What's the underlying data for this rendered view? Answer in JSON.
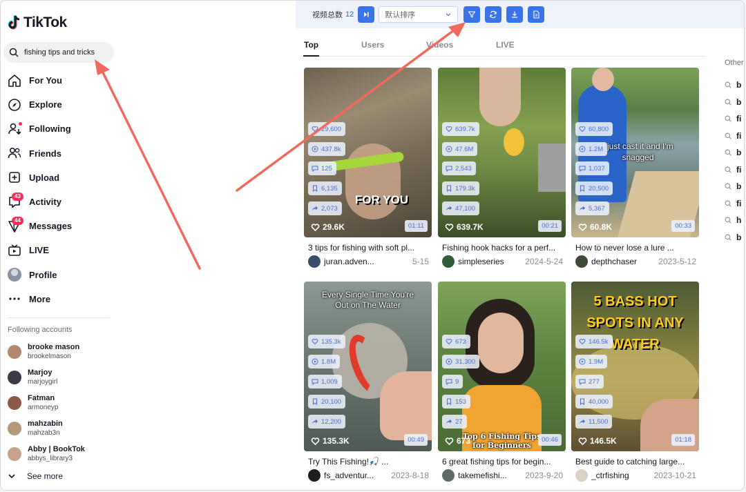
{
  "brand": {
    "logo_text": "TikTok"
  },
  "search": {
    "value": "fishing tips and tricks"
  },
  "nav": [
    {
      "label": "For You",
      "icon": "home-icon"
    },
    {
      "label": "Explore",
      "icon": "compass-icon"
    },
    {
      "label": "Following",
      "icon": "following-icon"
    },
    {
      "label": "Friends",
      "icon": "friends-icon"
    },
    {
      "label": "Upload",
      "icon": "upload-icon"
    },
    {
      "label": "Activity",
      "icon": "activity-icon",
      "badge": "43"
    },
    {
      "label": "Messages",
      "icon": "messages-icon",
      "badge": "44"
    },
    {
      "label": "LIVE",
      "icon": "live-icon"
    },
    {
      "label": "Profile",
      "icon": "avatar"
    },
    {
      "label": "More",
      "icon": "more-icon"
    }
  ],
  "following": {
    "title": "Following accounts",
    "accounts": [
      {
        "name": "brooke mason",
        "user": "brookelmason",
        "color": "#b08a6e"
      },
      {
        "name": "Marjoy",
        "user": "marjoygirl",
        "color": "#3c3a44"
      },
      {
        "name": "Fatman",
        "user": "armoneyp",
        "color": "#8c5a4a"
      },
      {
        "name": "mahzabin",
        "user": "mahzab3n",
        "color": "#b49a7a"
      },
      {
        "name": "Abby | BookTok",
        "user": "abbys_library3",
        "color": "#c7a38e"
      }
    ],
    "see_more": "See more"
  },
  "toolbar": {
    "label": "视频总数",
    "count": "12",
    "sort": "默认排序"
  },
  "tabs": [
    "Top",
    "Users",
    "Videos",
    "LIVE"
  ],
  "videos": [
    {
      "likes_small": "29,600",
      "plays": "437.8k",
      "comments": "125",
      "saves": "6,135",
      "shares": "2,073",
      "likes": "29.6K",
      "duration": "01:11",
      "caption": "3 tips for fishing with soft pl...",
      "author": "juran.adven...",
      "date": "5-15",
      "overlay": "FOR YOU"
    },
    {
      "likes_small": "639.7k",
      "plays": "47.6M",
      "comments": "2,543",
      "saves": "179.3k",
      "shares": "47,100",
      "likes": "639.7K",
      "duration": "00:21",
      "caption": "Fishing hook hacks for a perf...",
      "author": "simpleseries",
      "date": "2024-5-24",
      "overlay": ""
    },
    {
      "likes_small": "60,800",
      "plays": "1.2M",
      "comments": "1,037",
      "saves": "20,500",
      "shares": "5,367",
      "likes": "60.8K",
      "duration": "00:33",
      "caption": "How to never lose a lure ...",
      "author": "depthchaser",
      "date": "2023-5-12",
      "overlay": "I just cast it and I'm snagged"
    },
    {
      "likes_small": "135.3k",
      "plays": "1.8M",
      "comments": "1,009",
      "saves": "20,100",
      "shares": "12,200",
      "likes": "135.3K",
      "duration": "00:49",
      "caption": "Try This Fishing!🎣 ...",
      "author": "fs_adventur...",
      "date": "2023-8-18",
      "overlay": "Every Single Time You're Out on The Water"
    },
    {
      "likes_small": "673",
      "plays": "31,300",
      "comments": "9",
      "saves": "153",
      "shares": "27",
      "likes": "673",
      "duration": "00:46",
      "caption": "6 great fishing tips for begin...",
      "author": "takemefishi...",
      "date": "2023-9-20",
      "overlay": "Top 6 Fishing Tips for Beginners"
    },
    {
      "likes_small": "146.5k",
      "plays": "1.9M",
      "comments": "277",
      "saves": "40,000",
      "shares": "11,500",
      "likes": "146.5K",
      "duration": "01:18",
      "caption": "Best guide to catching large...",
      "author": "_ctrfishing",
      "date": "2023-10-21",
      "overlay": "5 BASS HOT SPOTS IN ANY WATER"
    }
  ],
  "others": {
    "title": "Other",
    "items": [
      "b",
      "b",
      "fi",
      "fi",
      "b",
      "fi",
      "b",
      "fi",
      "h",
      "b"
    ]
  }
}
